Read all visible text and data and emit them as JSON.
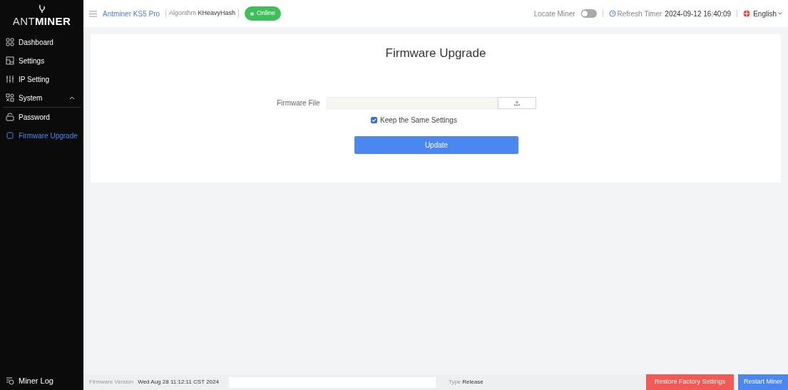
{
  "logo": {
    "text_left": "ANT",
    "text_right": "MINER"
  },
  "sidebar": {
    "items": [
      {
        "label": "Dashboard",
        "kind": "grid",
        "selected": false
      },
      {
        "label": "Settings",
        "kind": "panels",
        "selected": false
      },
      {
        "label": "IP Setting",
        "kind": "sliders",
        "selected": false
      },
      {
        "label": "System",
        "kind": "system",
        "selected": false,
        "expanded": true,
        "children": [
          {
            "label": "Password",
            "kind": "lock",
            "selected": false
          },
          {
            "label": "Firmware Upgrade",
            "kind": "chip",
            "selected": true
          }
        ]
      }
    ],
    "footer_item": {
      "label": "Miner Log"
    }
  },
  "header": {
    "model": "Antminer KS5 Pro",
    "algorithm_label": "Algorithm",
    "algorithm": "KHeavyHash",
    "status": "Online",
    "locate_label": "Locate Miner",
    "locate_on": false,
    "refresh_label": "Refresh Timer",
    "refresh_time": "2024-09-12 16:40:09",
    "language": "English"
  },
  "page": {
    "title": "Firmware Upgrade",
    "file_label": "Firmware File",
    "keep_settings": {
      "label": "Keep the Same Settings",
      "checked": true
    },
    "update_button": "Update"
  },
  "status_bar": {
    "version_label": "Firmware Version",
    "version": "Wed Aug 28 11:12:11 CST 2024",
    "type_label": "Type",
    "type": "Release",
    "buttons": [
      {
        "label": "Restore Factory Settings",
        "kind": "danger"
      },
      {
        "label": "Restart Miner",
        "kind": "primary"
      }
    ]
  }
}
